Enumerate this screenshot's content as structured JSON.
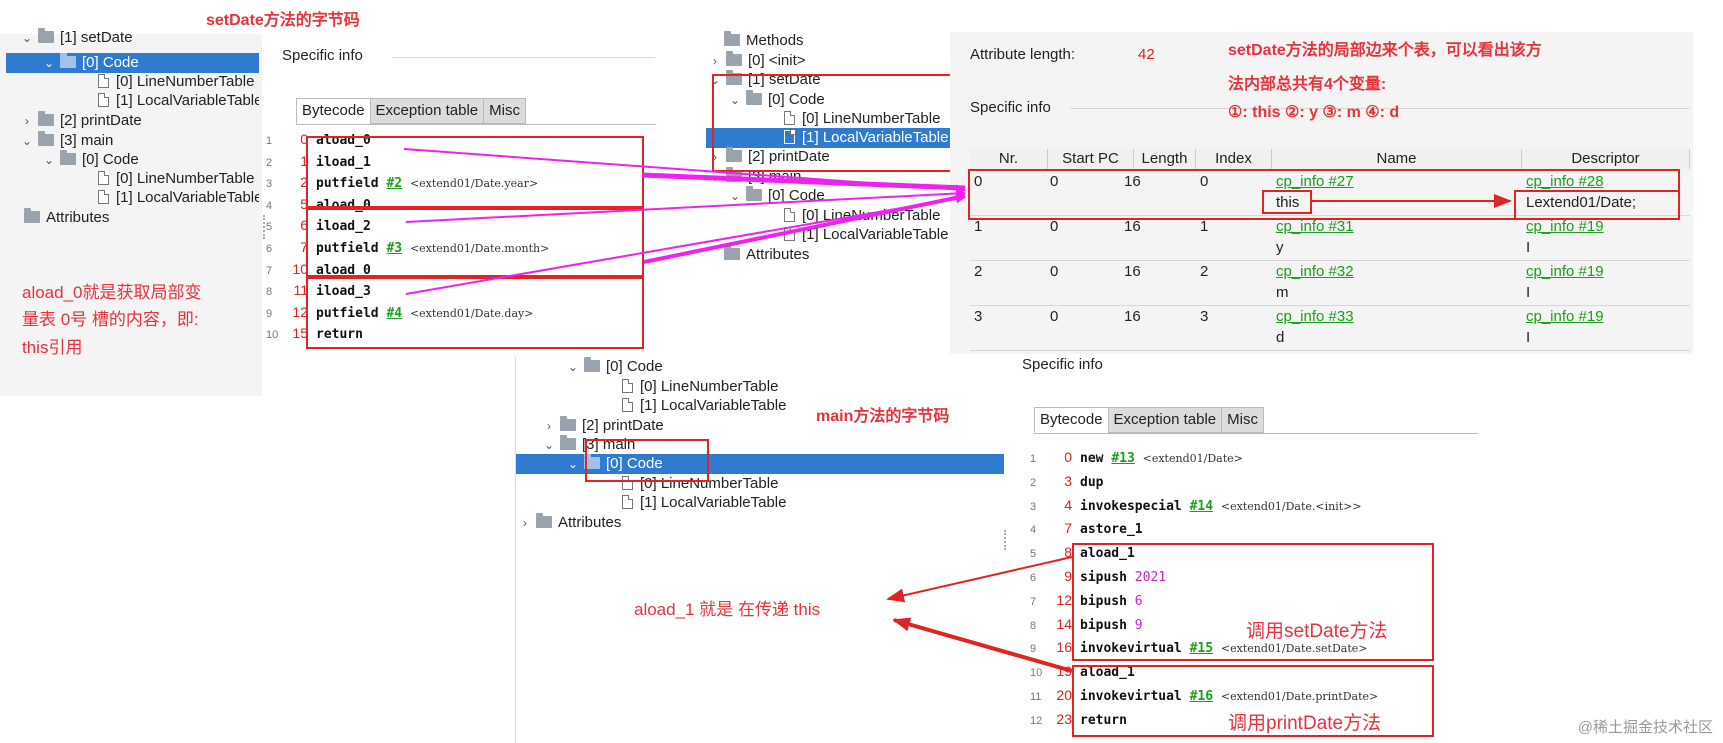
{
  "annotations": {
    "setdate_bytecode_title": "setDate方法的字节码",
    "aload0_note_l1": "aload_0就是获取局部变",
    "aload0_note_l2": "量表 0号 槽的内容，即:",
    "aload0_note_l3": "this引用",
    "local_var_note_l1": "setDate方法的局部边来个表，可以看出该方",
    "local_var_note_l2": "法内部总共有4个变量:",
    "local_var_note_l3": "①: this  ②: y  ③: m  ④: d",
    "main_bytecode_title": "main方法的字节码",
    "aload1_note": "aload_1 就是 在传递 this",
    "call_setdate": "调用setDate方法",
    "call_printdate": "调用printDate方法",
    "watermark": "@稀土掘金技术社区"
  },
  "left_tree": {
    "items": [
      {
        "arrow": "⌄",
        "kind": "folder",
        "label": "[1] setDate"
      },
      {
        "arrow": "⌄",
        "kind": "folder",
        "label": "[0] Code"
      },
      {
        "arrow": "",
        "kind": "file",
        "label": "[0] LineNumberTable"
      },
      {
        "arrow": "",
        "kind": "file",
        "label": "[1] LocalVariableTable"
      },
      {
        "arrow": "›",
        "kind": "folder",
        "label": "[2] printDate"
      },
      {
        "arrow": "⌄",
        "kind": "folder",
        "label": "[3] main"
      },
      {
        "arrow": "⌄",
        "kind": "folder",
        "label": "[0] Code"
      },
      {
        "arrow": "",
        "kind": "file",
        "label": "[0] LineNumberTable"
      },
      {
        "arrow": "",
        "kind": "file",
        "label": "[1] LocalVariableTable"
      },
      {
        "arrow": "",
        "kind": "folder",
        "label": "Attributes"
      }
    ]
  },
  "left_code": {
    "specific_info": "Specific info",
    "tabs": [
      "Bytecode",
      "Exception table",
      "Misc"
    ],
    "rows": [
      {
        "ln": "1",
        "pc": "0",
        "op": "aload_0",
        "ref": "",
        "cmt": ""
      },
      {
        "ln": "2",
        "pc": "1",
        "op": "iload_1",
        "ref": "",
        "cmt": ""
      },
      {
        "ln": "3",
        "pc": "2",
        "op": "putfield",
        "ref": "#2",
        "cmt": "<extend01/Date.year>"
      },
      {
        "ln": "4",
        "pc": "5",
        "op": "aload_0",
        "ref": "",
        "cmt": ""
      },
      {
        "ln": "5",
        "pc": "6",
        "op": "iload_2",
        "ref": "",
        "cmt": ""
      },
      {
        "ln": "6",
        "pc": "7",
        "op": "putfield",
        "ref": "#3",
        "cmt": "<extend01/Date.month>"
      },
      {
        "ln": "7",
        "pc": "10",
        "op": "aload_0",
        "ref": "",
        "cmt": ""
      },
      {
        "ln": "8",
        "pc": "11",
        "op": "iload_3",
        "ref": "",
        "cmt": ""
      },
      {
        "ln": "9",
        "pc": "12",
        "op": "putfield",
        "ref": "#4",
        "cmt": "<extend01/Date.day>"
      },
      {
        "ln": "10",
        "pc": "15",
        "op": "return",
        "ref": "",
        "cmt": ""
      }
    ]
  },
  "mid_tree": {
    "items": [
      {
        "arrow": "",
        "kind": "folder",
        "label": "Methods"
      },
      {
        "arrow": "›",
        "kind": "folder",
        "label": "[0] <init>"
      },
      {
        "arrow": "⌄",
        "kind": "folder",
        "label": "[1] setDate"
      },
      {
        "arrow": "⌄",
        "kind": "folder",
        "label": "[0] Code"
      },
      {
        "arrow": "",
        "kind": "file",
        "label": "[0] LineNumberTable"
      },
      {
        "arrow": "",
        "kind": "file",
        "label": "[1] LocalVariableTable"
      },
      {
        "arrow": "›",
        "kind": "folder",
        "label": "[2] printDate"
      },
      {
        "arrow": "⌄",
        "kind": "folder",
        "label": "[3] main"
      },
      {
        "arrow": "⌄",
        "kind": "folder",
        "label": "[0] Code"
      },
      {
        "arrow": "",
        "kind": "file",
        "label": "[0] LineNumberTable"
      },
      {
        "arrow": "",
        "kind": "file",
        "label": "[1] LocalVariableTable"
      },
      {
        "arrow": "",
        "kind": "folder",
        "label": "Attributes"
      }
    ]
  },
  "lvt": {
    "attr_length_label": "Attribute length:",
    "attr_length_value": "42",
    "specific_info": "Specific info",
    "headers": [
      "Nr.",
      "Start PC",
      "Length",
      "Index",
      "Name",
      "Descriptor"
    ],
    "rows": [
      {
        "nr": "0",
        "start": "0",
        "len": "16",
        "idx": "0",
        "name_ref": "cp_info #27",
        "name": "this",
        "desc_ref": "cp_info #28",
        "desc": "Lextend01/Date;"
      },
      {
        "nr": "1",
        "start": "0",
        "len": "16",
        "idx": "1",
        "name_ref": "cp_info #31",
        "name": "y",
        "desc_ref": "cp_info #19",
        "desc": "I"
      },
      {
        "nr": "2",
        "start": "0",
        "len": "16",
        "idx": "2",
        "name_ref": "cp_info #32",
        "name": "m",
        "desc_ref": "cp_info #19",
        "desc": "I"
      },
      {
        "nr": "3",
        "start": "0",
        "len": "16",
        "idx": "3",
        "name_ref": "cp_info #33",
        "name": "d",
        "desc_ref": "cp_info #19",
        "desc": "I"
      }
    ]
  },
  "bottom_tree": {
    "items": [
      {
        "arrow": "⌄",
        "kind": "folder",
        "label": "[0] Code"
      },
      {
        "arrow": "",
        "kind": "file",
        "label": "[0] LineNumberTable"
      },
      {
        "arrow": "",
        "kind": "file",
        "label": "[1] LocalVariableTable"
      },
      {
        "arrow": "›",
        "kind": "folder",
        "label": "[2] printDate"
      },
      {
        "arrow": "⌄",
        "kind": "folder",
        "label": "[3] main"
      },
      {
        "arrow": "⌄",
        "kind": "folder",
        "label": "[0] Code"
      },
      {
        "arrow": "",
        "kind": "file",
        "label": "[0] LineNumberTable"
      },
      {
        "arrow": "",
        "kind": "file",
        "label": "[1] LocalVariableTable"
      },
      {
        "arrow": "›",
        "kind": "folder",
        "label": "Attributes"
      }
    ]
  },
  "main_code": {
    "specific_info": "Specific info",
    "tabs": [
      "Bytecode",
      "Exception table",
      "Misc"
    ],
    "rows": [
      {
        "ln": "1",
        "pc": "0",
        "op": "new",
        "ref": "#13",
        "num": "",
        "cmt": "<extend01/Date>"
      },
      {
        "ln": "2",
        "pc": "3",
        "op": "dup",
        "ref": "",
        "num": "",
        "cmt": ""
      },
      {
        "ln": "3",
        "pc": "4",
        "op": "invokespecial",
        "ref": "#14",
        "num": "",
        "cmt": "<extend01/Date.<init>>"
      },
      {
        "ln": "4",
        "pc": "7",
        "op": "astore_1",
        "ref": "",
        "num": "",
        "cmt": ""
      },
      {
        "ln": "5",
        "pc": "8",
        "op": "aload_1",
        "ref": "",
        "num": "",
        "cmt": ""
      },
      {
        "ln": "6",
        "pc": "9",
        "op": "sipush",
        "ref": "",
        "num": "2021",
        "cmt": ""
      },
      {
        "ln": "7",
        "pc": "12",
        "op": "bipush",
        "ref": "",
        "num": "6",
        "cmt": ""
      },
      {
        "ln": "8",
        "pc": "14",
        "op": "bipush",
        "ref": "",
        "num": "9",
        "cmt": ""
      },
      {
        "ln": "9",
        "pc": "16",
        "op": "invokevirtual",
        "ref": "#15",
        "num": "",
        "cmt": "<extend01/Date.setDate>"
      },
      {
        "ln": "10",
        "pc": "19",
        "op": "aload_1",
        "ref": "",
        "num": "",
        "cmt": ""
      },
      {
        "ln": "11",
        "pc": "20",
        "op": "invokevirtual",
        "ref": "#16",
        "num": "",
        "cmt": "<extend01/Date.printDate>"
      },
      {
        "ln": "12",
        "pc": "23",
        "op": "return",
        "ref": "",
        "num": "",
        "cmt": ""
      }
    ]
  },
  "colors": {
    "annotation_red": "#e8323c",
    "arrow_magenta": "#ee22ee",
    "selection_blue": "#2e7bcf",
    "ref_green": "#1aa01a"
  }
}
